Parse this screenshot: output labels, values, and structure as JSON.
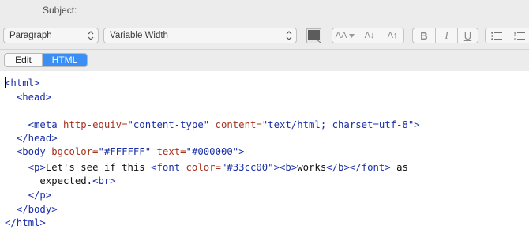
{
  "header": {
    "subject_label": "Subject:"
  },
  "toolbar": {
    "paragraph_select": "Paragraph",
    "font_select": "Variable Width",
    "color_swatch": "#5c5c5c",
    "font_size_buttons": [
      "AA",
      "A↓",
      "A↑"
    ],
    "style_buttons": [
      "B",
      "I",
      "U"
    ]
  },
  "mode_tabs": {
    "edit": "Edit",
    "html": "HTML",
    "active": "HTML"
  },
  "code": {
    "lines": [
      {
        "segments": [
          {
            "t": "tag",
            "v": "<html>"
          }
        ]
      },
      {
        "segments": [
          {
            "t": "txt",
            "v": "  "
          },
          {
            "t": "tag",
            "v": "<head>"
          }
        ]
      },
      {
        "segments": []
      },
      {
        "segments": [
          {
            "t": "txt",
            "v": "    "
          },
          {
            "t": "tag",
            "v": "<meta "
          },
          {
            "t": "attr",
            "v": "http-equiv="
          },
          {
            "t": "val",
            "v": "\"content-type\""
          },
          {
            "t": "txt",
            "v": " "
          },
          {
            "t": "attr",
            "v": "content="
          },
          {
            "t": "val",
            "v": "\"text/html; charset=utf-8\""
          },
          {
            "t": "tag",
            "v": ">"
          }
        ]
      },
      {
        "segments": [
          {
            "t": "txt",
            "v": "  "
          },
          {
            "t": "tag",
            "v": "</head>"
          }
        ]
      },
      {
        "segments": [
          {
            "t": "txt",
            "v": "  "
          },
          {
            "t": "tag",
            "v": "<body "
          },
          {
            "t": "attr",
            "v": "bgcolor="
          },
          {
            "t": "val",
            "v": "\"#FFFFFF\""
          },
          {
            "t": "txt",
            "v": " "
          },
          {
            "t": "attr",
            "v": "text="
          },
          {
            "t": "val",
            "v": "\"#000000\""
          },
          {
            "t": "tag",
            "v": ">"
          }
        ]
      },
      {
        "segments": [
          {
            "t": "txt",
            "v": "    "
          },
          {
            "t": "tag",
            "v": "<p>"
          },
          {
            "t": "txt",
            "v": "Let's see if this "
          },
          {
            "t": "tag",
            "v": "<font "
          },
          {
            "t": "attr",
            "v": "color="
          },
          {
            "t": "val",
            "v": "\"#33cc00\""
          },
          {
            "t": "tag",
            "v": "><b>"
          },
          {
            "t": "txt",
            "v": "works"
          },
          {
            "t": "tag",
            "v": "</b></font>"
          },
          {
            "t": "txt",
            "v": " as"
          }
        ]
      },
      {
        "segments": [
          {
            "t": "txt",
            "v": "      expected."
          },
          {
            "t": "tag",
            "v": "<br>"
          }
        ]
      },
      {
        "segments": [
          {
            "t": "txt",
            "v": "    "
          },
          {
            "t": "tag",
            "v": "</p>"
          }
        ]
      },
      {
        "segments": [
          {
            "t": "txt",
            "v": "  "
          },
          {
            "t": "tag",
            "v": "</body>"
          }
        ]
      },
      {
        "segments": [
          {
            "t": "tag",
            "v": "</html>"
          }
        ]
      }
    ]
  }
}
